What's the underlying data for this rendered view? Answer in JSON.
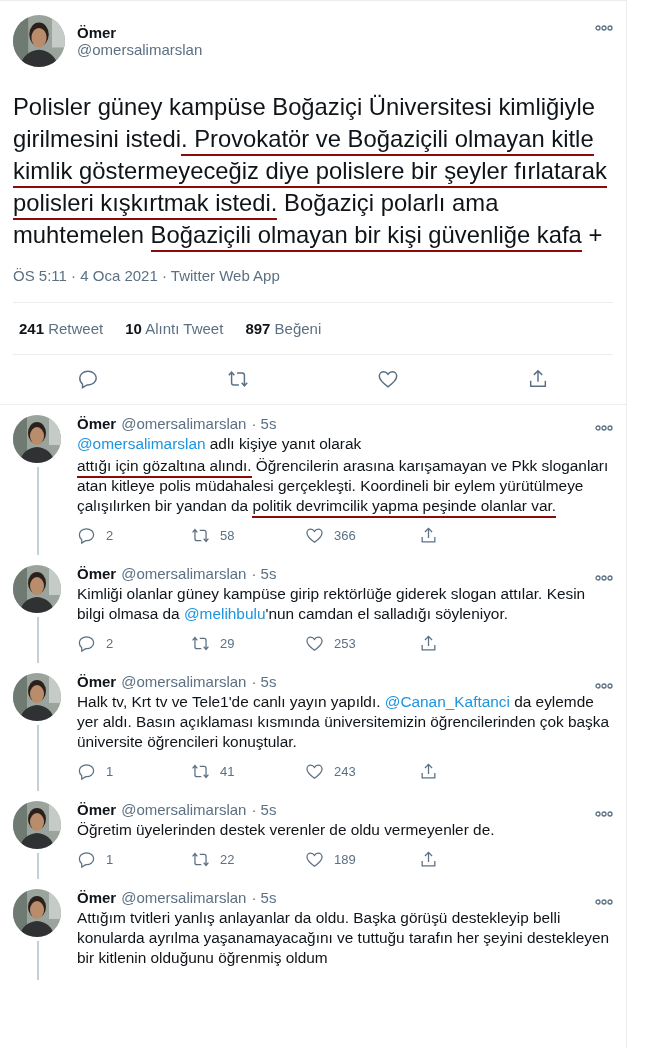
{
  "main_tweet": {
    "name": "Ömer",
    "handle": "@omersalimarslan",
    "body": [
      {
        "text": "Polisler güney kampüse Boğaziçi Üniversitesi kimliğiyle girilmesini istedi",
        "underlined": false
      },
      {
        "text": ". Provokatör ve Boğaziçili olmayan kitle kimlik göstermeyeceğiz diye polislere bir şeyler fırlatarak polisleri kışkırtmak istedi.",
        "underlined": true
      },
      {
        "text": " Boğaziçi polarlı ama muhtemelen ",
        "underlined": false
      },
      {
        "text": "Boğaziçili olmayan bir kişi güvenliğe kafa",
        "underlined": true
      },
      {
        "text": " +",
        "underlined": false
      }
    ],
    "meta": "ÖS 5:11 · 4 Oca 2021 · Twitter Web App",
    "stats": [
      {
        "count": "241",
        "label": "Retweet"
      },
      {
        "count": "10",
        "label": "Alıntı Tweet"
      },
      {
        "count": "897",
        "label": "Beğeni"
      }
    ]
  },
  "replies": [
    {
      "name": "Ömer",
      "handle": "@omersalimarslan",
      "time": "· 5s",
      "replying_to": {
        "mention": "@omersalimarslan",
        "text": " adlı kişiye yanıt olarak"
      },
      "body": [
        {
          "kind": "text",
          "text": "attığı için gözaltına alındı.",
          "underlined": true
        },
        {
          "kind": "text",
          "text": " Öğrencilerin arasına karışamayan ve Pkk sloganları atan kitleye polis müdahalesi gerçekleşti. Koordineli bir eylem yürütülmeye çalışılırken bir yandan da ",
          "underlined": false
        },
        {
          "kind": "text",
          "text": "politik devrimcilik yapma peşinde olanlar var.",
          "underlined": true
        }
      ],
      "replies": "2",
      "retweets": "58",
      "likes": "366"
    },
    {
      "name": "Ömer",
      "handle": "@omersalimarslan",
      "time": "· 5s",
      "body": [
        {
          "kind": "text",
          "text": "Kimliği olanlar güney kampüse girip rektörlüğe giderek slogan attılar. Kesin bilgi olmasa da ",
          "underlined": false
        },
        {
          "kind": "mention",
          "text": "@melihbulu",
          "underlined": false
        },
        {
          "kind": "text",
          "text": "'nun camdan el salladığı söyleniyor.",
          "underlined": false
        }
      ],
      "replies": "2",
      "retweets": "29",
      "likes": "253"
    },
    {
      "name": "Ömer",
      "handle": "@omersalimarslan",
      "time": "· 5s",
      "body": [
        {
          "kind": "text",
          "text": "Halk tv, Krt tv ve Tele1'de canlı yayın yapıldı. ",
          "underlined": false
        },
        {
          "kind": "mention",
          "text": "@Canan_Kaftanci",
          "underlined": false
        },
        {
          "kind": "text",
          "text": " da eylemde yer aldı. Basın açıklaması kısmında üniversitemizin öğrencilerinden çok başka üniversite öğrencileri konuştular.",
          "underlined": false
        }
      ],
      "replies": "1",
      "retweets": "41",
      "likes": "243"
    },
    {
      "name": "Ömer",
      "handle": "@omersalimarslan",
      "time": "· 5s",
      "body": [
        {
          "kind": "text",
          "text": "Öğretim üyelerinden destek verenler de oldu vermeyenler de.",
          "underlined": false
        }
      ],
      "replies": "1",
      "retweets": "22",
      "likes": "189"
    },
    {
      "name": "Ömer",
      "handle": "@omersalimarslan",
      "time": "· 5s",
      "body": [
        {
          "kind": "text",
          "text": "Attığım tvitleri yanlış anlayanlar da oldu. Başka görüşü destekleyip belli konularda ayrılma yaşanamayacağını ve tuttuğu tarafın her şeyini destekleyen bir kitlenin olduğunu öğrenmiş oldum",
          "underlined": false
        }
      ]
    }
  ]
}
